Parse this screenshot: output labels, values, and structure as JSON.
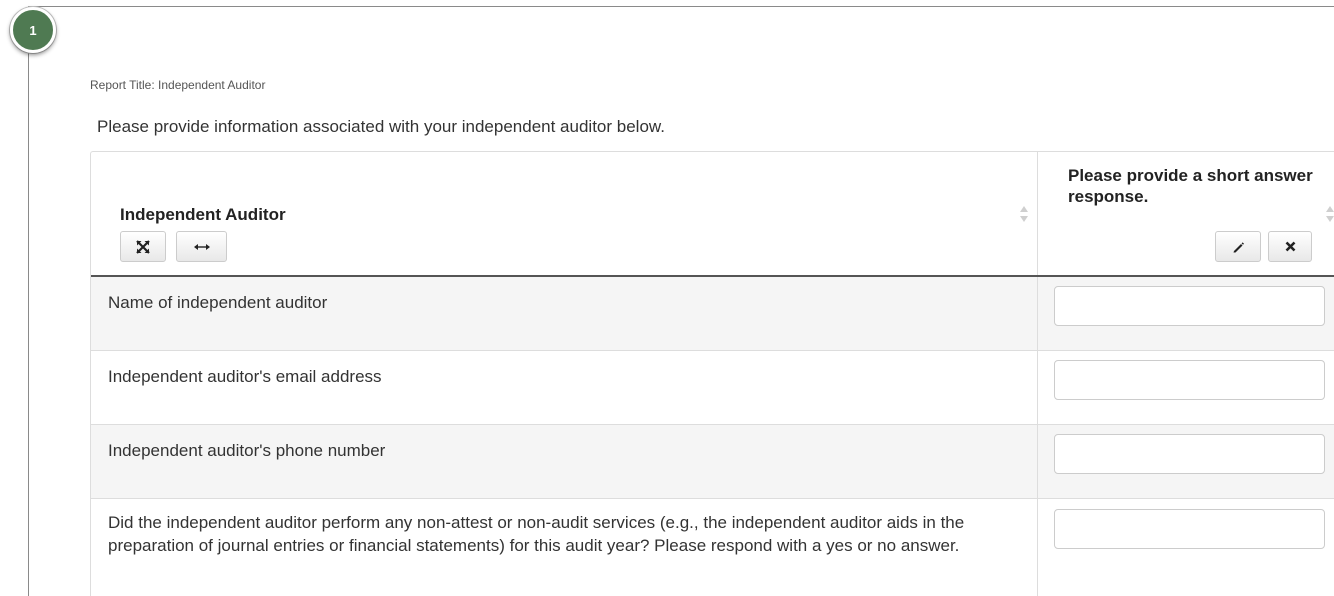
{
  "step": {
    "number": "1"
  },
  "report": {
    "title": "Report Title: Independent Auditor"
  },
  "intro": "Please provide information associated with your independent auditor below.",
  "table": {
    "col1_header": "Independent Auditor",
    "col2_header": "Please provide a short answer response.",
    "rows": [
      {
        "label": "Name of independent auditor",
        "value": ""
      },
      {
        "label": "Independent auditor's email address",
        "value": ""
      },
      {
        "label": "Independent auditor's phone number",
        "value": ""
      },
      {
        "label": "Did the independent auditor perform any non-attest or non-audit services (e.g., the independent auditor aids in the preparation of journal entries or financial statements) for this audit year? Please respond with a yes or no answer.",
        "value": ""
      }
    ]
  },
  "icons": {
    "expand": "expand-arrows-icon",
    "width": "horizontal-resize-icon",
    "edit": "pencil-icon",
    "clear": "close-icon",
    "sort": "sort-arrows-icon"
  },
  "colors": {
    "badge": "#4f7a52",
    "row_alt": "#f5f5f5",
    "header_rule": "#555555"
  }
}
